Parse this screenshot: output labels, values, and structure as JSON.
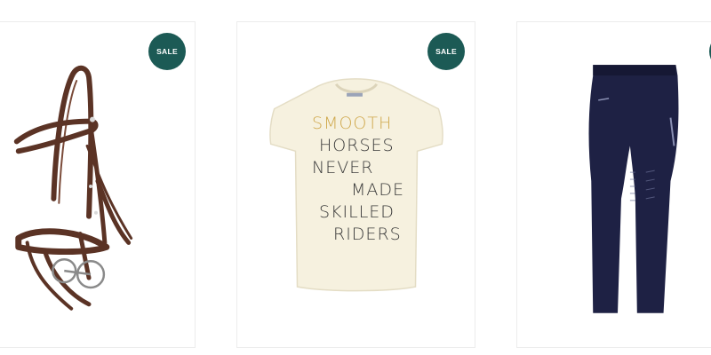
{
  "colors": {
    "badge_bg": "#1c5a55",
    "bridle_leather": "#5b3325",
    "shirt_fabric": "#f6f1df",
    "shirt_print_gold": "#cfa84c",
    "shirt_print_dark": "#3a3a3a",
    "leggings_navy": "#1e2144"
  },
  "products": [
    {
      "name_icon": "bridle-image",
      "badge": "SALE"
    },
    {
      "name_icon": "t-shirt-image",
      "badge": "SALE",
      "print_lines": [
        "SMOOTH",
        "HORSES",
        "NEVER",
        "MADE",
        "SKILLED",
        "RIDERS"
      ]
    },
    {
      "name_icon": "riding-leggings-image",
      "badge": ""
    }
  ]
}
